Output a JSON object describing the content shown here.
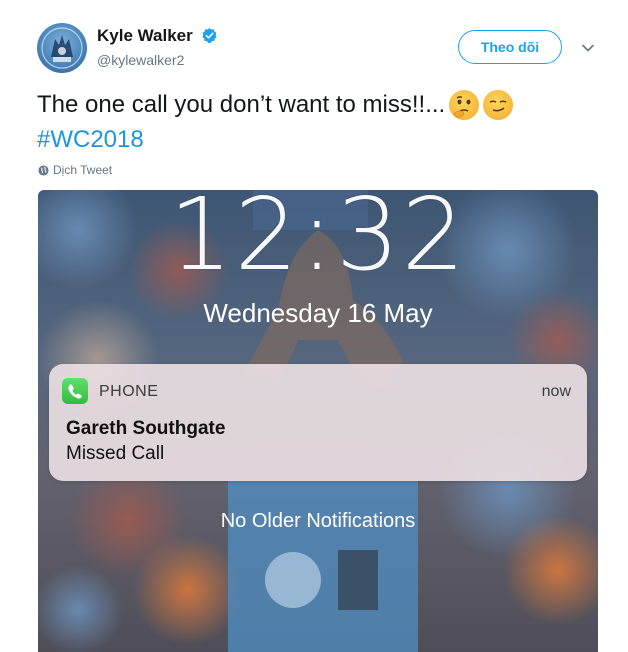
{
  "author": {
    "display_name": "Kyle Walker",
    "handle": "@kylewalker2",
    "verified": true,
    "avatar_icon": "team-crest-avatar"
  },
  "follow_button": {
    "label": "Theo dõi"
  },
  "menu_icon": "chevron-down-icon",
  "tweet": {
    "text": "The one call you don’t want to miss!!...",
    "emojis": [
      "thinking-face-emoji",
      "smirking-face-emoji"
    ],
    "hashtag": "#WC2018"
  },
  "translate": {
    "label": "Dịch Tweet",
    "icon": "globe-icon"
  },
  "media": {
    "lock_screen": {
      "time": "12:32",
      "date": "Wednesday 16 May",
      "notification": {
        "app": "PHONE",
        "time": "now",
        "title": "Gareth Southgate",
        "body": "Missed Call",
        "icon": "phone-icon"
      },
      "footer": "No Older Notifications"
    }
  },
  "colors": {
    "accent": "#1da1f2",
    "hashtag": "#1b95e0",
    "secondary_text": "#657786",
    "verified": "#1da1f2",
    "phone_green": "#35c447"
  }
}
